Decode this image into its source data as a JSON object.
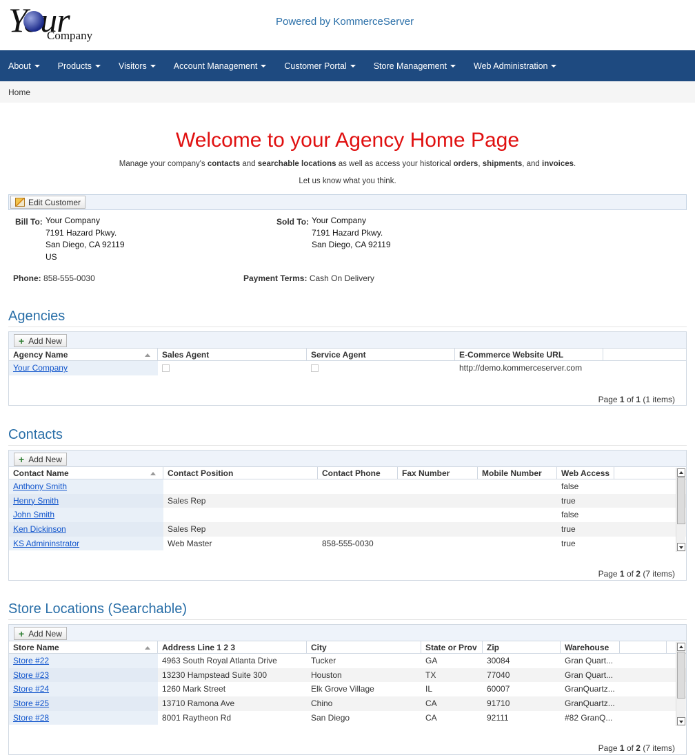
{
  "header": {
    "logo_your": "Your",
    "logo_company": "Company",
    "powered": "Powered by KommerceServer"
  },
  "nav": [
    "About",
    "Products",
    "Visitors",
    "Account Management",
    "Customer Portal",
    "Store Management",
    "Web Administration"
  ],
  "breadcrumb": "Home",
  "welcome": {
    "title": "Welcome to your Agency Home Page",
    "intro_parts": [
      "Manage your company's ",
      "contacts",
      " and ",
      "searchable locations",
      " as well as access your historical ",
      "orders",
      ", ",
      "shipments",
      ", and ",
      "invoices",
      "."
    ],
    "feedback": "Let us know what you think."
  },
  "customer": {
    "edit_label": "Edit Customer",
    "bill_to_label": "Bill To:",
    "bill_to": [
      "Your Company",
      "7191 Hazard Pkwy.",
      "San Diego, CA 92119",
      "US"
    ],
    "sold_to_label": "Sold To:",
    "sold_to": [
      "Your Company",
      "7191 Hazard Pkwy.",
      "San Diego, CA 92119"
    ],
    "phone_label": "Phone:",
    "phone": "858-555-0030",
    "terms_label": "Payment Terms:",
    "terms": "Cash On Delivery"
  },
  "agencies": {
    "title": "Agencies",
    "add_label": "Add New",
    "columns": [
      "Agency Name",
      "Sales Agent",
      "Service Agent",
      "E-Commerce Website URL"
    ],
    "rows": [
      {
        "name": "Your Company",
        "sales": false,
        "service": false,
        "url": "http://demo.kommerceserver.com"
      }
    ],
    "pager": {
      "prefix": "Page ",
      "page": "1",
      "of": " of ",
      "total": "1",
      "items": " (1 items)"
    }
  },
  "contacts": {
    "title": "Contacts",
    "add_label": "Add New",
    "columns": [
      "Contact Name",
      "Contact Position",
      "Contact Phone",
      "Fax Number",
      "Mobile Number",
      "Web Access"
    ],
    "rows": [
      [
        "Anthony Smith",
        "",
        "",
        "",
        "",
        "false"
      ],
      [
        "Henry Smith",
        "Sales Rep",
        "",
        "",
        "",
        "true"
      ],
      [
        "John Smith",
        "",
        "",
        "",
        "",
        "false"
      ],
      [
        "Ken Dickinson",
        "Sales Rep",
        "",
        "",
        "",
        "true"
      ],
      [
        "KS Admininstrator",
        "Web Master",
        "858-555-0030",
        "",
        "",
        "true"
      ]
    ],
    "pager": {
      "prefix": "Page ",
      "page": "1",
      "of": " of ",
      "total": "2",
      "items": " (7 items)"
    }
  },
  "stores": {
    "title": "Store Locations (Searchable)",
    "add_label": "Add New",
    "columns": [
      "Store Name",
      "Address Line 1 2 3",
      "City",
      "State or Prov",
      "Zip",
      "Warehouse"
    ],
    "rows": [
      [
        "Store #22",
        "4963 South Royal Atlanta Drive",
        "Tucker",
        "GA",
        "30084",
        "Gran Quart..."
      ],
      [
        "Store #23",
        "13230 Hampstead Suite 300",
        "Houston",
        "TX",
        "77040",
        "Gran Quart..."
      ],
      [
        "Store #24",
        "1260 Mark Street",
        "Elk Grove Village",
        "IL",
        "60007",
        "GranQuartz..."
      ],
      [
        "Store #25",
        "13710 Ramona Ave",
        "Chino",
        "CA",
        "91710",
        "GranQuartz..."
      ],
      [
        "Store #28",
        "8001 Raytheon Rd",
        "San Diego",
        "CA",
        "92111",
        "#82 GranQ..."
      ]
    ],
    "pager": {
      "prefix": "Page ",
      "page": "1",
      "of": " of ",
      "total": "2",
      "items": " (7 items)"
    }
  }
}
